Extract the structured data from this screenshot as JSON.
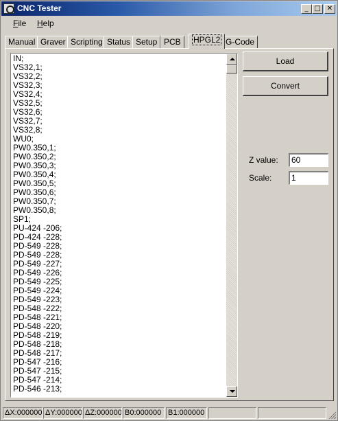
{
  "window": {
    "title": "CNC Tester"
  },
  "menu": [
    {
      "label": "File"
    },
    {
      "label": "Help"
    }
  ],
  "tabs": [
    {
      "label": "Manual"
    },
    {
      "label": "Graver"
    },
    {
      "label": "Scripting"
    },
    {
      "label": "Status"
    },
    {
      "label": "Setup"
    },
    {
      "label": "PCB"
    },
    {
      "label": "HPGL2",
      "active": true
    },
    {
      "label": "G-Code"
    }
  ],
  "editor": {
    "lines": [
      "IN;",
      "VS32,1;",
      "VS32,2;",
      "VS32,3;",
      "VS32,4;",
      "VS32,5;",
      "VS32,6;",
      "VS32,7;",
      "VS32,8;",
      "WU0;",
      "PW0.350,1;",
      "PW0.350,2;",
      "PW0.350,3;",
      "PW0.350,4;",
      "PW0.350,5;",
      "PW0.350,6;",
      "PW0.350,7;",
      "PW0.350,8;",
      "SP1;",
      "PU-424 -206;",
      "PD-424 -228;",
      "PD-549 -228;",
      "PD-549 -228;",
      "PD-549 -227;",
      "PD-549 -226;",
      "PD-549 -225;",
      "PD-549 -224;",
      "PD-549 -223;",
      "PD-548 -222;",
      "PD-548 -221;",
      "PD-548 -220;",
      "PD-548 -219;",
      "PD-548 -218;",
      "PD-548 -217;",
      "PD-547 -216;",
      "PD-547 -215;",
      "PD-547 -214;",
      "PD-546 -213;"
    ]
  },
  "buttons": {
    "load": "Load",
    "convert": "Convert"
  },
  "fields": {
    "z_value": {
      "label": "Z value:",
      "value": "60"
    },
    "scale": {
      "label": "Scale:",
      "value": "1"
    }
  },
  "status": {
    "dx": "ΔX:000000",
    "dy": "ΔY:000000",
    "dz": "ΔZ:000000",
    "b0": "B0:000000",
    "b1": "B1:000000"
  }
}
